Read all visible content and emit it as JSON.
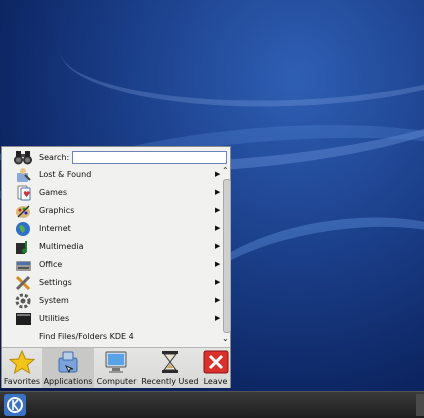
{
  "search": {
    "label": "Search:",
    "value": ""
  },
  "menu_items": [
    {
      "label": "Lost & Found",
      "icon": "lost-found-icon",
      "submenu": true
    },
    {
      "label": "Games",
      "icon": "games-icon",
      "submenu": true
    },
    {
      "label": "Graphics",
      "icon": "graphics-icon",
      "submenu": true
    },
    {
      "label": "Internet",
      "icon": "internet-icon",
      "submenu": true
    },
    {
      "label": "Multimedia",
      "icon": "multimedia-icon",
      "submenu": true
    },
    {
      "label": "Office",
      "icon": "office-icon",
      "submenu": true
    },
    {
      "label": "Settings",
      "icon": "settings-icon",
      "submenu": true
    },
    {
      "label": "System",
      "icon": "system-icon",
      "submenu": true
    },
    {
      "label": "Utilities",
      "icon": "utilities-icon",
      "submenu": true
    },
    {
      "label": "Find Files/Folders KDE 4",
      "icon": "",
      "submenu": false
    }
  ],
  "submenu_arrow": "▶",
  "scroll": {
    "up": "⌃",
    "down": "⌄"
  },
  "tabs": [
    {
      "label": "Favorites",
      "icon": "star-icon"
    },
    {
      "label": "Applications",
      "icon": "applications-icon"
    },
    {
      "label": "Computer",
      "icon": "computer-icon"
    },
    {
      "label": "Recently Used",
      "icon": "hourglass-icon"
    },
    {
      "label": "Leave",
      "icon": "leave-icon"
    }
  ],
  "active_tab": "Applications",
  "colors": {
    "desktop": "#1b3f8a",
    "panel": "#2a2a2a",
    "leave": "#d9302c",
    "favorites": "#f2c318"
  }
}
